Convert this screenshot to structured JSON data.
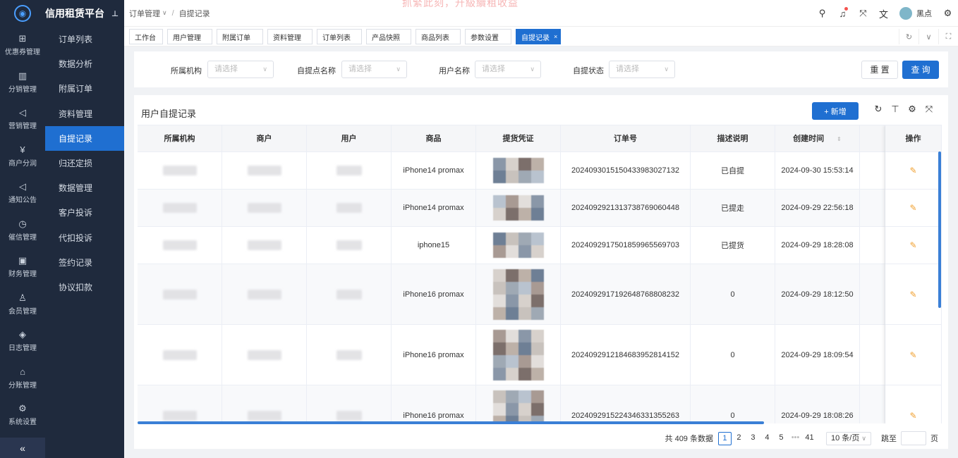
{
  "app": {
    "title": "信用租赁平台",
    "notice": "抓緊此刻，升級續租收益"
  },
  "rail": [
    {
      "label": "优惠券管理",
      "icon": "gift-icon",
      "glyph": "⊞"
    },
    {
      "label": "分销管理",
      "icon": "chart-icon",
      "glyph": "▥"
    },
    {
      "label": "营销管理",
      "icon": "megaphone-icon",
      "glyph": "◁"
    },
    {
      "label": "商户分润",
      "icon": "yen-icon",
      "glyph": "¥"
    },
    {
      "label": "通知公告",
      "icon": "notification-icon",
      "glyph": "◁"
    },
    {
      "label": "催信管理",
      "icon": "clock-icon",
      "glyph": "◷"
    },
    {
      "label": "财务管理",
      "icon": "finance-icon",
      "glyph": "▣"
    },
    {
      "label": "会员管理",
      "icon": "member-icon",
      "glyph": "♙"
    },
    {
      "label": "日志管理",
      "icon": "shield-icon",
      "glyph": "◈"
    },
    {
      "label": "分账管理",
      "icon": "split-icon",
      "glyph": "⌂"
    },
    {
      "label": "系统设置",
      "icon": "gear-icon",
      "glyph": "⚙"
    }
  ],
  "sidebar": [
    {
      "label": "订单列表"
    },
    {
      "label": "数据分析"
    },
    {
      "label": "附属订单"
    },
    {
      "label": "资料管理"
    },
    {
      "label": "自提记录",
      "active": true
    },
    {
      "label": "归还定损"
    },
    {
      "label": "数据管理"
    },
    {
      "label": "客户投诉"
    },
    {
      "label": "代扣投诉"
    },
    {
      "label": "签约记录"
    },
    {
      "label": "协议扣款"
    }
  ],
  "breadcrumb": {
    "parent": "订单管理",
    "current": "自提记录"
  },
  "user": {
    "name": "黑点"
  },
  "tabs": [
    {
      "label": "工作台"
    },
    {
      "label": "用户管理"
    },
    {
      "label": "附属订单"
    },
    {
      "label": "资料管理"
    },
    {
      "label": "订单列表"
    },
    {
      "label": "产品快照"
    },
    {
      "label": "商品列表"
    },
    {
      "label": "参数设置"
    },
    {
      "label": "自提记录",
      "active": true
    }
  ],
  "filters": [
    {
      "label": "所属机构",
      "placeholder": "请选择"
    },
    {
      "label": "自提点名称",
      "placeholder": "请选择"
    },
    {
      "label": "用户名称",
      "placeholder": "请选择"
    },
    {
      "label": "自提状态",
      "placeholder": "请选择"
    }
  ],
  "buttons": {
    "reset": "重 置",
    "query": "查 询",
    "add": "+ 新增"
  },
  "panel": {
    "title": "用户自提记录"
  },
  "table": {
    "columns": [
      "所属机构",
      "商户",
      "用户",
      "商品",
      "提货凭证",
      "订单号",
      "描述说明",
      "创建时间",
      "",
      "操作"
    ],
    "rows": [
      {
        "product": "iPhone14 promax",
        "order": "202409301515043398302 7132",
        "desc": "已自提",
        "time": "2024-09-30 15:53:14"
      },
      {
        "product": "iPhone14 promax",
        "order": "20240929213137387690604 48",
        "desc": "已提走",
        "time": "2024-09-29 22:56:18"
      },
      {
        "product": "iphone15",
        "order": "20240929175018599655697 03",
        "desc": "已提货",
        "time": "2024-09-29 18:28:08"
      },
      {
        "product": "iPhone16 promax",
        "order": "20240929171926487688082 32",
        "desc": "0",
        "time": "2024-09-29 18:12:50"
      },
      {
        "product": "iPhone16 promax",
        "order": "20240929121846839528141 52",
        "desc": "0",
        "time": "2024-09-29 18:09:54"
      },
      {
        "product": "iPhone16 promax",
        "order": "20240929152243463313552 63",
        "desc": "0",
        "time": "2024-09-29 18:08:26"
      }
    ]
  },
  "pagination": {
    "total_text": "共 409 条数据",
    "pages": [
      "1",
      "2",
      "3",
      "4",
      "5",
      "•••",
      "41"
    ],
    "current": "1",
    "page_size": "10 条/页",
    "jump_label": "跳至",
    "page_suffix": "页"
  }
}
